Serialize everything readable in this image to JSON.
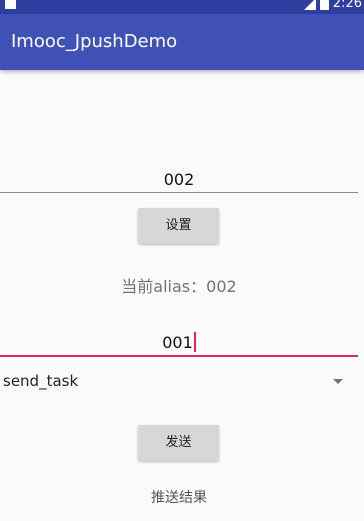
{
  "status_bar": {
    "time": "2:26",
    "icons": [
      "notification-icon",
      "signal-icon",
      "battery-icon"
    ]
  },
  "app_bar": {
    "title": "Imooc_JpushDemo",
    "color": "#3f51b5"
  },
  "alias_input": {
    "value": "002"
  },
  "set_button": {
    "label": "设置"
  },
  "alias_status": {
    "text": "当前alias：002"
  },
  "target_input": {
    "value": "001",
    "accent_color": "#e91e63"
  },
  "task_spinner": {
    "selected": "send_task",
    "icon": "dropdown-arrow-icon"
  },
  "send_button": {
    "label": "发送"
  },
  "result": {
    "text": "推送结果"
  }
}
